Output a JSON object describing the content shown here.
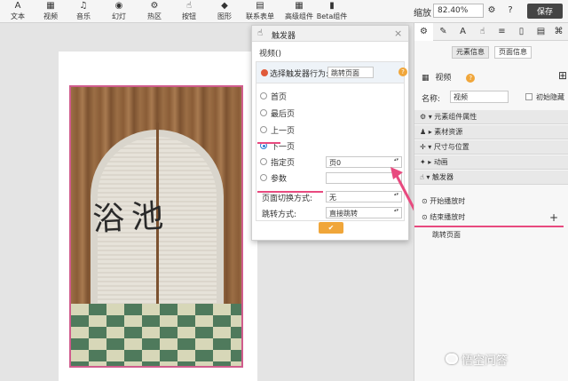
{
  "toolbar": {
    "tools": [
      {
        "label": "文本",
        "icon": "A"
      },
      {
        "label": "视频",
        "icon": "▦"
      },
      {
        "label": "音乐",
        "icon": "♫"
      },
      {
        "label": "幻灯",
        "icon": "◉"
      },
      {
        "label": "热区",
        "icon": "⚙"
      },
      {
        "label": "按钮",
        "icon": "☝"
      },
      {
        "label": "图形",
        "icon": "◆"
      },
      {
        "label": "联系表单",
        "icon": "▤"
      },
      {
        "label": "高级组件",
        "icon": "▦"
      },
      {
        "label": "Beta组件",
        "icon": "▮"
      }
    ],
    "zoom_label": "缩放",
    "zoom_value": "82.40%",
    "save_label": "保存"
  },
  "canvas": {
    "calligraphy": "浴池"
  },
  "dialog": {
    "title": "触发器",
    "subtitle": "视频()",
    "action_label": "选择触发器行为:",
    "action_value": "跳转页面",
    "help": "?",
    "options": [
      "首页",
      "最后页",
      "上一页",
      "下一页",
      "指定页",
      "参数"
    ],
    "selected_option": "下一页",
    "page_select": "页0",
    "param_select": "",
    "transition_label": "页面切换方式:",
    "transition_value": "无",
    "jump_label": "跳转方式:",
    "jump_value": "直接跳转",
    "ok_label": "✔"
  },
  "right_panel": {
    "subtabs": [
      "元素信息",
      "页面信息"
    ],
    "active_subtab": "元素信息",
    "element_type": "视频",
    "name_label": "名称:",
    "name_value": "视频",
    "hide_label": "初始隐藏",
    "sections": [
      "元素组件属性",
      "素材资源",
      "尺寸与位置",
      "动画",
      "触发器"
    ],
    "triggers": [
      "开始播放时",
      "结束播放时"
    ],
    "trigger_action": "跳转页面",
    "add": "+"
  },
  "watermark": "悟空问答",
  "colors": {
    "accent_pink": "#e84a7f",
    "save_bg": "#454545",
    "ok_orange": "#f0a63a",
    "radio_blue": "#2d7fd3"
  }
}
